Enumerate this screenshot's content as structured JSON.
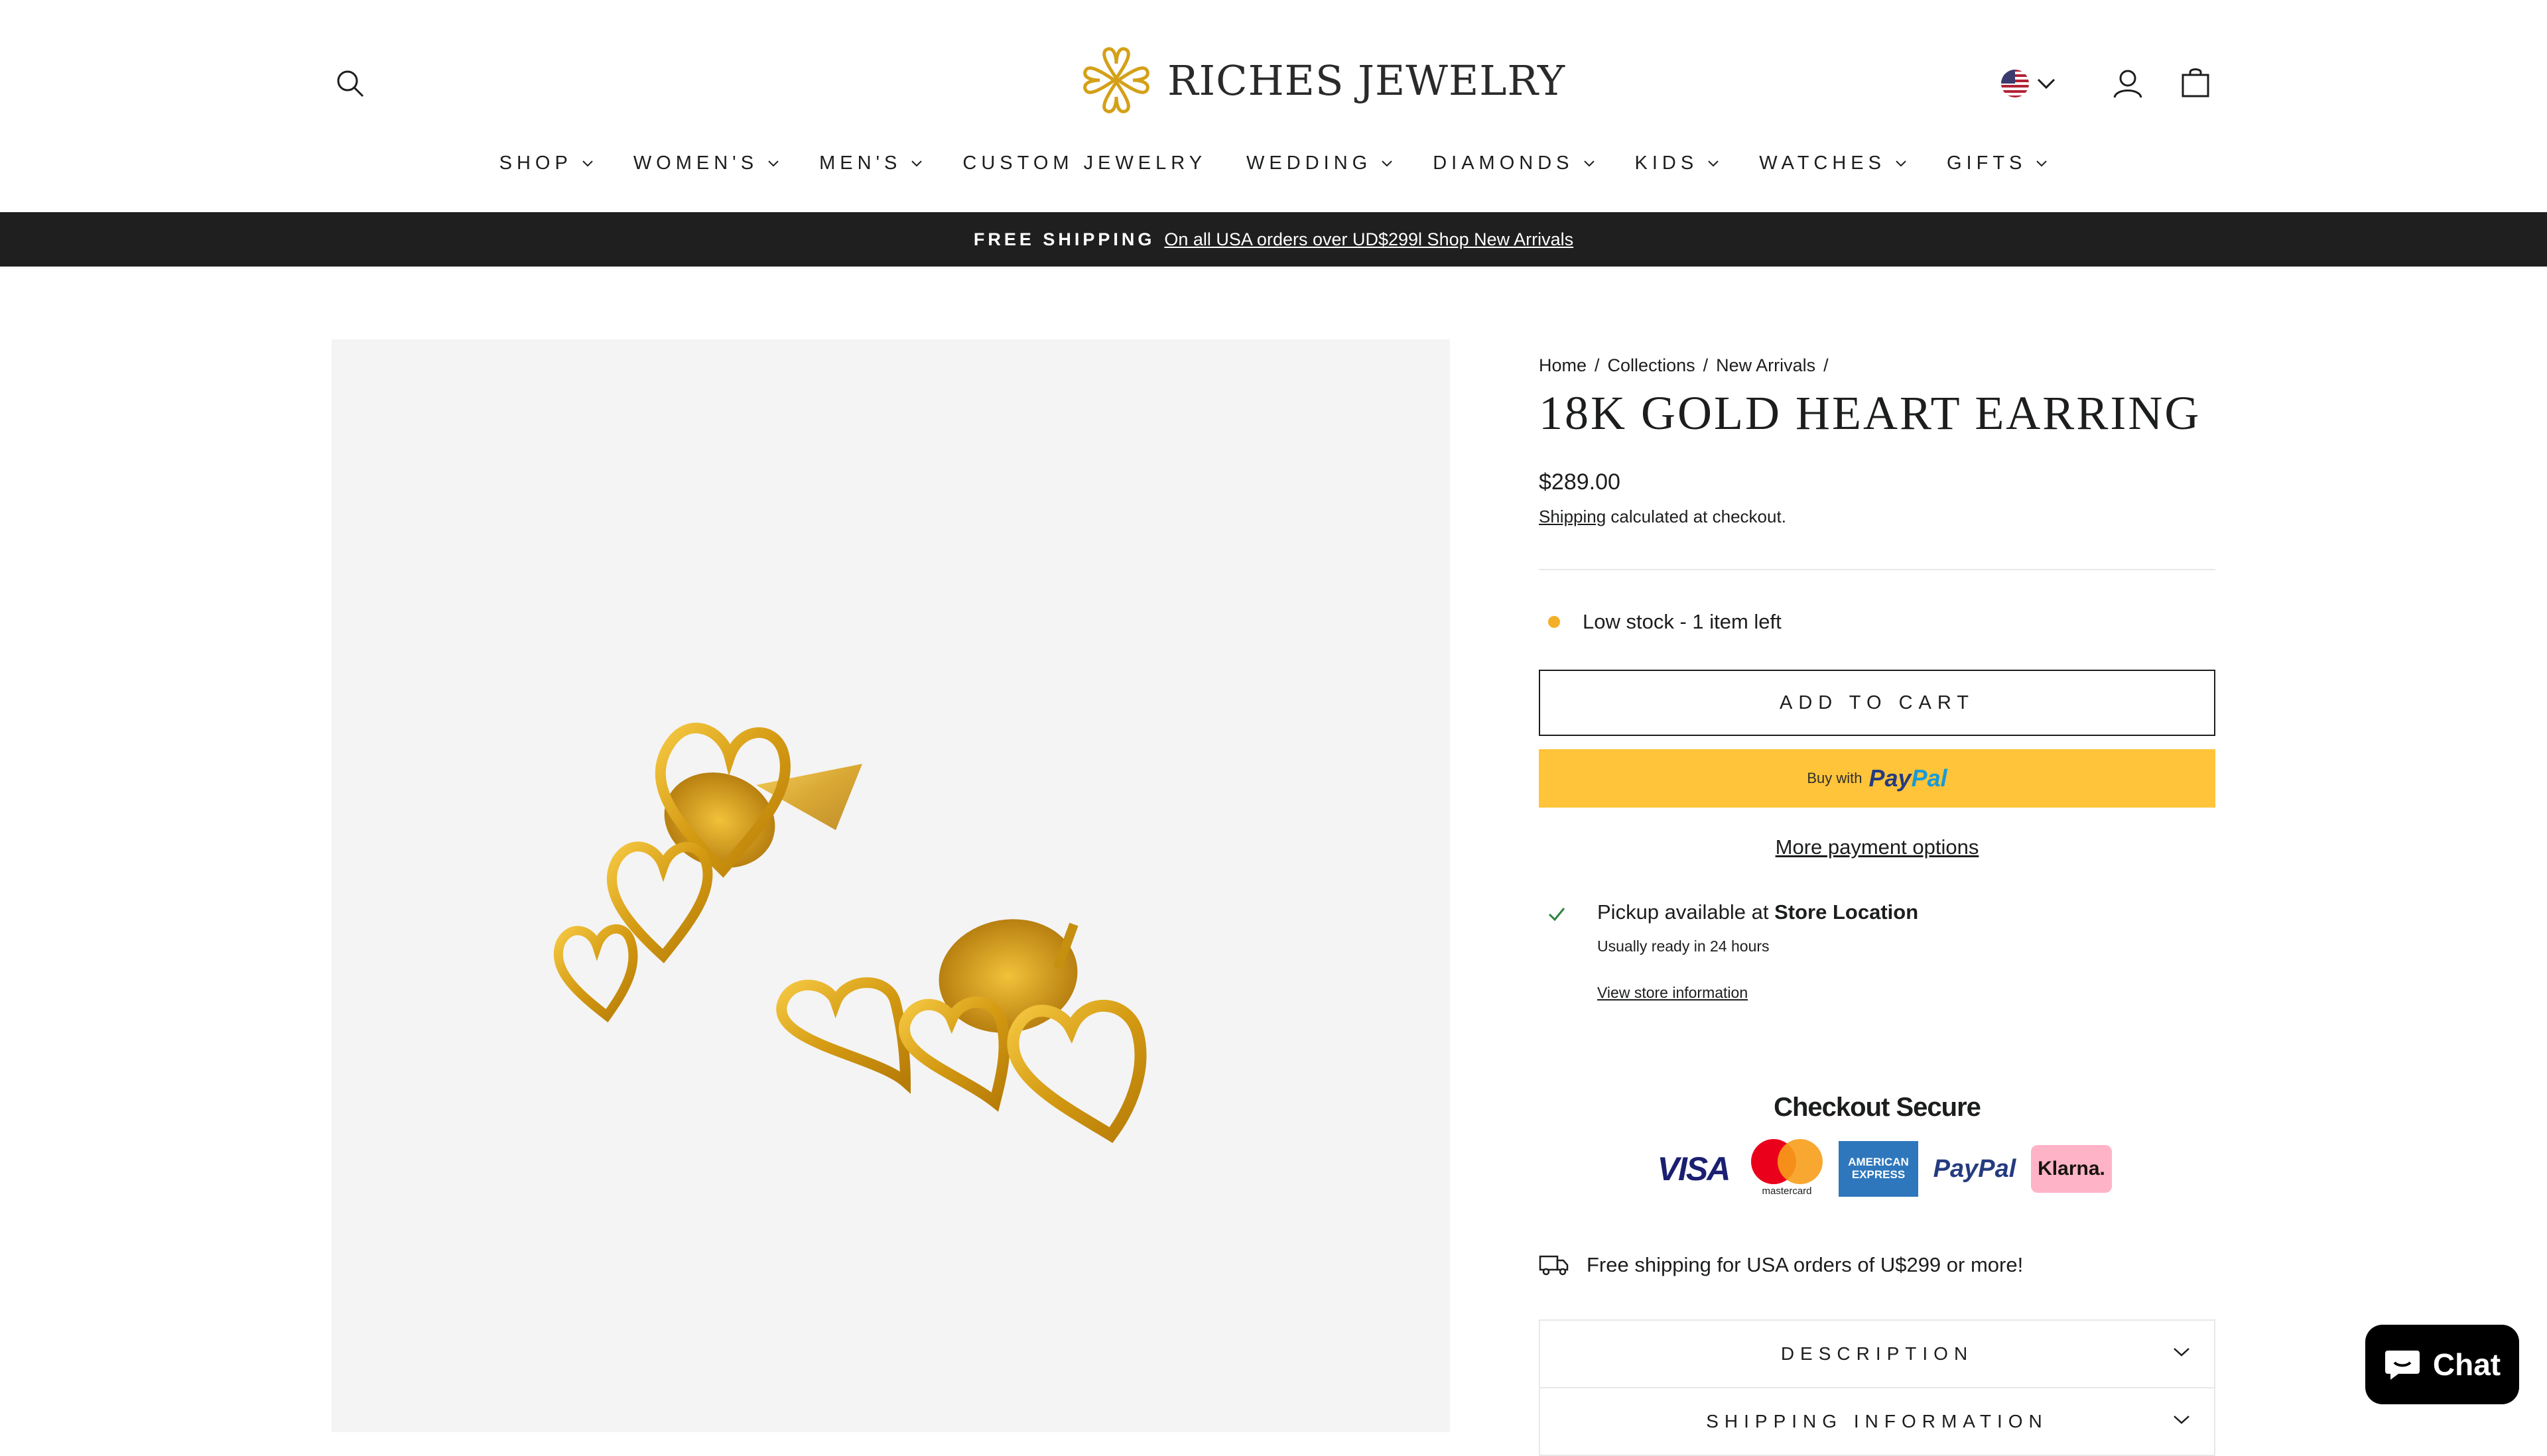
{
  "brand": {
    "name": "RICHES JEWELRY"
  },
  "header": {
    "search_icon": "search-icon",
    "country_flag": "us-flag-icon",
    "account_icon": "user-icon",
    "cart_icon": "bag-icon"
  },
  "nav": {
    "items": [
      {
        "label": "SHOP",
        "dropdown": true
      },
      {
        "label": "WOMEN'S",
        "dropdown": true
      },
      {
        "label": "MEN'S",
        "dropdown": true
      },
      {
        "label": "CUSTOM JEWELRY",
        "dropdown": false
      },
      {
        "label": "WEDDING",
        "dropdown": true
      },
      {
        "label": "DIAMONDS",
        "dropdown": true
      },
      {
        "label": "KIDS",
        "dropdown": true
      },
      {
        "label": "WATCHES",
        "dropdown": true
      },
      {
        "label": "GIFTS",
        "dropdown": true
      }
    ]
  },
  "announcement": {
    "strong": "FREE SHIPPING",
    "link": "On all USA orders over UD$299l Shop New Arrivals"
  },
  "product": {
    "breadcrumb": [
      "Home",
      "/",
      "Collections",
      "/",
      "New Arrivals",
      "/"
    ],
    "title": "18K GOLD HEART EARRING",
    "price": "$289.00",
    "shipping_link": "Shipping",
    "shipping_rest": " calculated at checkout.",
    "stock": "Low stock - 1 item left",
    "stock_color": "#f4af29",
    "add_to_cart": "ADD TO CART",
    "paypal_buy_with": "Buy with",
    "paypal_pay": "Pay",
    "paypal_pal": "Pal",
    "more_payment": "More payment options",
    "pickup_prefix": "Pickup available at ",
    "pickup_location": "Store Location",
    "pickup_ready": "Usually ready in 24 hours",
    "pickup_view": "View store information",
    "checkout_secure": "Checkout Secure",
    "cards": {
      "visa": "VISA",
      "mastercard": "mastercard",
      "amex_1": "AMERICAN",
      "amex_2": "EXPRESS",
      "paypal": "PayPal",
      "klarna": "Klarna."
    },
    "free_shipping": "Free shipping for USA orders of U$299 or more!",
    "accordions": [
      "DESCRIPTION",
      "SHIPPING INFORMATION"
    ]
  },
  "chat": {
    "label": "Chat"
  }
}
